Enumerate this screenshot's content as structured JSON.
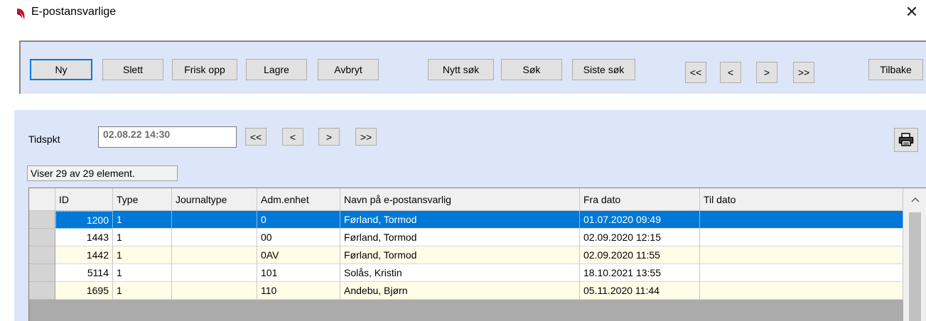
{
  "window": {
    "title": "E-postansvarlige",
    "close_glyph": "✕"
  },
  "toolbar": {
    "new": "Ny",
    "delete": "Slett",
    "refresh": "Frisk opp",
    "save": "Lagre",
    "cancel": "Avbryt",
    "new_search": "Nytt søk",
    "search": "Søk",
    "last_search": "Siste søk",
    "first": "<<",
    "prev": "<",
    "next": ">",
    "last": ">>",
    "back": "Tilbake"
  },
  "filter": {
    "label": "Tidspkt",
    "value": "02.08.22 14:30",
    "first": "<<",
    "prev": "<",
    "next": ">",
    "last": ">>"
  },
  "status": {
    "count_text": "Viser 29 av 29 element."
  },
  "icons": {
    "print": "printer-icon",
    "scroll_up": "chevron-up-icon",
    "app": "app-logo-icon"
  },
  "colors": {
    "selection": "#0078d7",
    "panel": "#dde6f8",
    "row_alt": "#fefde8"
  },
  "grid": {
    "columns": [
      "ID",
      "Type",
      "Journaltype",
      "Adm.enhet",
      "Navn på e-postansvarlig",
      "Fra dato",
      "Til dato"
    ],
    "rows": [
      {
        "id": "1200",
        "type": "1",
        "journaltype": "",
        "adm": "0",
        "navn": "Førland, Tormod",
        "fra": "01.07.2020 09:49",
        "til": ""
      },
      {
        "id": "1443",
        "type": "1",
        "journaltype": "",
        "adm": "00",
        "navn": "Førland, Tormod",
        "fra": "02.09.2020 12:15",
        "til": ""
      },
      {
        "id": "1442",
        "type": "1",
        "journaltype": "",
        "adm": "0AV",
        "navn": "Førland, Tormod",
        "fra": "02.09.2020 11:55",
        "til": ""
      },
      {
        "id": "5114",
        "type": "1",
        "journaltype": "",
        "adm": "101",
        "navn": "Solås, Kristin",
        "fra": "18.10.2021 13:55",
        "til": ""
      },
      {
        "id": "1695",
        "type": "1",
        "journaltype": "",
        "adm": "110",
        "navn": "Andebu, Bjørn",
        "fra": "05.11.2020 11:44",
        "til": ""
      }
    ]
  }
}
